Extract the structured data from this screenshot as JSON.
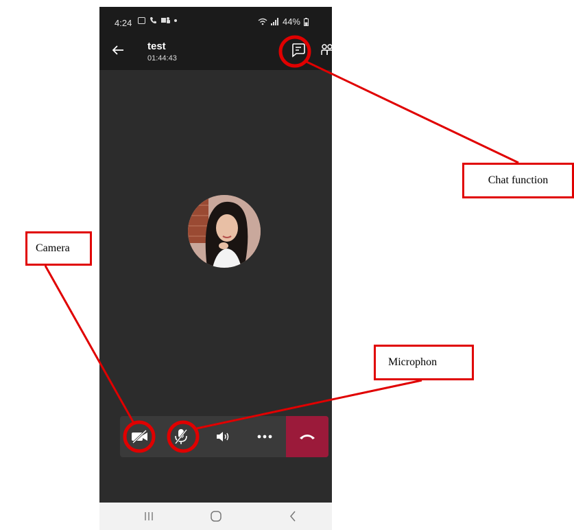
{
  "status_bar": {
    "time": "4:24",
    "battery": "44%"
  },
  "call_header": {
    "title": "test",
    "duration": "01:44:43",
    "back_icon": "arrow-left-icon",
    "chat_icon": "chat-icon",
    "add_people_icon": "add-people-icon"
  },
  "participant": {
    "avatar": "participant-avatar"
  },
  "controls": {
    "camera_icon": "camera-off-icon",
    "mic_icon": "mic-off-icon",
    "speaker_icon": "speaker-icon",
    "more_icon": "more-icon",
    "hangup_icon": "hangup-icon",
    "hangup_color": "#9b1a3a"
  },
  "nav_bar": {
    "recents_icon": "recents-icon",
    "home_icon": "home-icon",
    "back_icon": "back-icon"
  },
  "annotations": {
    "chat_label": "Chat function",
    "camera_label": "Camera",
    "mic_label": "Microphon",
    "color": "#e00000"
  }
}
